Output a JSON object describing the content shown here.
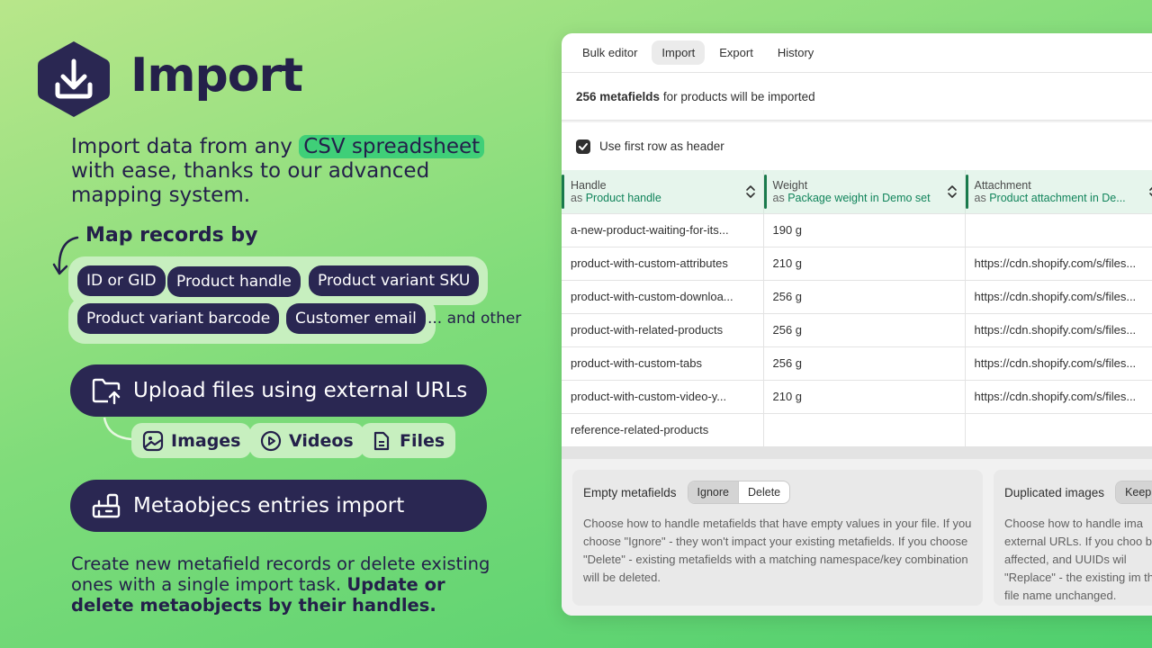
{
  "hero": {
    "title": "Import",
    "intro_before": "Import data from any ",
    "intro_highlight": "CSV spreadsheet",
    "intro_after": " with ease, thanks to our advanced mapping system."
  },
  "map_records": {
    "title": "Map records by",
    "chips": [
      "ID or GID",
      "Product handle",
      "Product variant SKU",
      "Product variant barcode",
      "Customer email"
    ],
    "more": "... and other"
  },
  "upload": {
    "label": "Upload files using external URLs",
    "types": [
      "Images",
      "Videos",
      "Files"
    ]
  },
  "metaobjects": {
    "label": "Metaobjecs entries import"
  },
  "outro": {
    "text": "Create new metafield records or delete existing ones with a single import task. ",
    "bold": "Update or delete metaobjects by their handles."
  },
  "app": {
    "tabs": [
      "Bulk editor",
      "Import",
      "Export",
      "History"
    ],
    "active_tab": "Import",
    "summary_bold": "256 metafields",
    "summary_rest": " for products will be imported",
    "header_checkbox": "Use first row as header",
    "columns": [
      {
        "name": "Handle",
        "as_prefix": "as ",
        "as": "Product handle"
      },
      {
        "name": "Weight",
        "as_prefix": "as ",
        "as": "Package weight in Demo set"
      },
      {
        "name": "Attachment",
        "as_prefix": "as ",
        "as": "Product attachment in De..."
      }
    ],
    "rows": [
      [
        "a-new-product-waiting-for-its...",
        "190 g",
        ""
      ],
      [
        "product-with-custom-attributes",
        "210 g",
        "https://cdn.shopify.com/s/files..."
      ],
      [
        "product-with-custom-downloa...",
        "256 g",
        "https://cdn.shopify.com/s/files..."
      ],
      [
        "product-with-related-products",
        "256 g",
        "https://cdn.shopify.com/s/files..."
      ],
      [
        "product-with-custom-tabs",
        "256 g",
        "https://cdn.shopify.com/s/files..."
      ],
      [
        "product-with-custom-video-y...",
        "210 g",
        "https://cdn.shopify.com/s/files..."
      ],
      [
        "reference-related-products",
        "",
        ""
      ]
    ],
    "options": [
      {
        "title": "Empty metafields",
        "choices": [
          "Ignore",
          "Delete"
        ],
        "selected": "Ignore",
        "description": "Choose how to handle metafields that have empty values in your file. If you choose \"Ignore\" - they won't impact your existing metafields. If you choose \"Delete\" - existing metafields with a matching namespace/key combination will be deleted."
      },
      {
        "title": "Duplicated images",
        "choices": [
          "Keep"
        ],
        "selected": "Keep",
        "description": "Choose how to handle ima external URLs. If you choo be affected, and UUIDs wil \"Replace\" - the existing im the file name unchanged."
      }
    ]
  },
  "colors": {
    "navy": "#2a2752",
    "accent_green": "#3fcf78",
    "chip_bg": "#c7efbf",
    "mapped_green": "#11845b"
  }
}
